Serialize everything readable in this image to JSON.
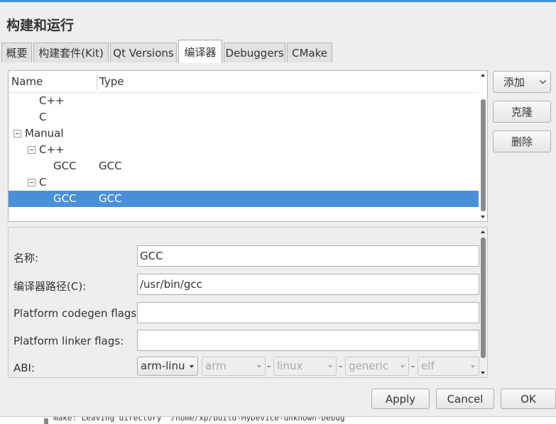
{
  "dialog": {
    "title": "构建和运行"
  },
  "tabs": [
    {
      "label": "概要"
    },
    {
      "label": "构建套件(Kit)"
    },
    {
      "label": "Qt Versions"
    },
    {
      "label": "编译器"
    },
    {
      "label": "Debuggers"
    },
    {
      "label": "CMake"
    }
  ],
  "active_tab": "编译器",
  "compiler_tree": {
    "columns": [
      "Name",
      "Type"
    ],
    "rows": [
      {
        "name": "C++",
        "type": ""
      },
      {
        "name": "C",
        "type": ""
      },
      {
        "name": "Manual",
        "type": ""
      },
      {
        "name": "C++",
        "type": ""
      },
      {
        "name": "GCC",
        "type": "GCC"
      },
      {
        "name": "C",
        "type": ""
      },
      {
        "name": "GCC",
        "type": "GCC",
        "selected": true
      }
    ]
  },
  "buttons": {
    "add": "添加",
    "clone": "克隆",
    "remove": "删除",
    "apply": "Apply",
    "cancel": "Cancel",
    "ok": "OK"
  },
  "details": {
    "name_label": "名称:",
    "name_value": "GCC",
    "path_label": "编译器路径(C):",
    "path_value": "/usr/bin/gcc",
    "codegen_label": "Platform codegen flags:",
    "codegen_value": "",
    "linker_label": "Platform linker flags:",
    "linker_value": "",
    "abi_label": "ABI:",
    "abi": {
      "main": "arm-linux",
      "arch": "arm",
      "os": "linux",
      "flavor": "generic",
      "format": "elf",
      "separator": "-"
    }
  },
  "log": {
    "line": "make: Leaving directory '/home/xp/build-MyDevice-unknown-Debug'"
  },
  "colors": {
    "selection": "#4a90d9",
    "accent": "#4a90d9"
  }
}
